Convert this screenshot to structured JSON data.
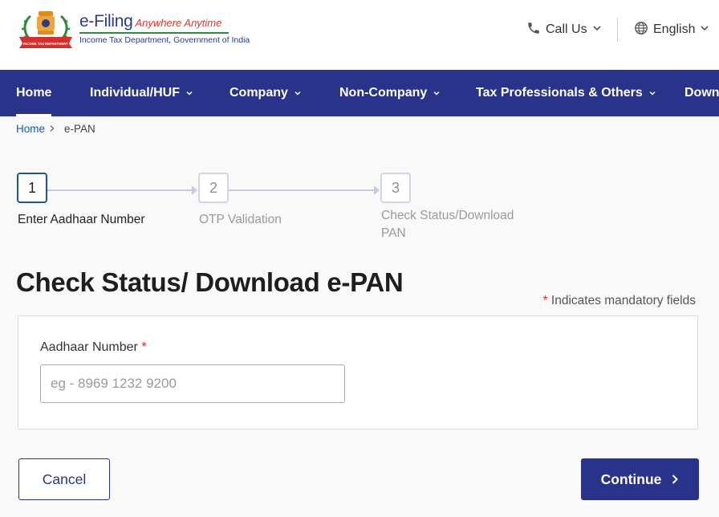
{
  "header": {
    "brand_name": "e-Filing",
    "brand_tagline": "Anywhere Anytime",
    "brand_subtitle": "Income Tax Department, Government of India",
    "emblem_text": "INCOME TAX DEPARTMENT",
    "call_label": "Call Us",
    "language_label": "English"
  },
  "nav": {
    "items": [
      {
        "label": "Home",
        "active": true
      },
      {
        "label": "Individual/HUF"
      },
      {
        "label": "Company"
      },
      {
        "label": "Non-Company"
      },
      {
        "label": "Tax Professionals & Others"
      },
      {
        "label": "Downloads"
      }
    ]
  },
  "breadcrumb": {
    "home": "Home",
    "current": "e-PAN"
  },
  "stepper": {
    "steps": [
      {
        "number": "1",
        "label": "Enter Aadhaar Number",
        "active": true
      },
      {
        "number": "2",
        "label": "OTP Validation"
      },
      {
        "number": "3",
        "label_line1": "Check Status/Download",
        "label_line2": "PAN"
      }
    ]
  },
  "page": {
    "title": "Check Status/ Download e-PAN",
    "mandatory_star": "*",
    "mandatory_note": "Indicates mandatory fields"
  },
  "form": {
    "aadhaar_label": "Aadhaar Number",
    "required_star": "*",
    "aadhaar_placeholder": "eg - 8969 1232 9200",
    "aadhaar_value": ""
  },
  "actions": {
    "cancel_label": "Cancel",
    "continue_label": "Continue"
  },
  "colors": {
    "primary": "#29338a",
    "active_step_border": "#1c52a6",
    "required": "#d62e2e",
    "link": "#1a57b8"
  }
}
